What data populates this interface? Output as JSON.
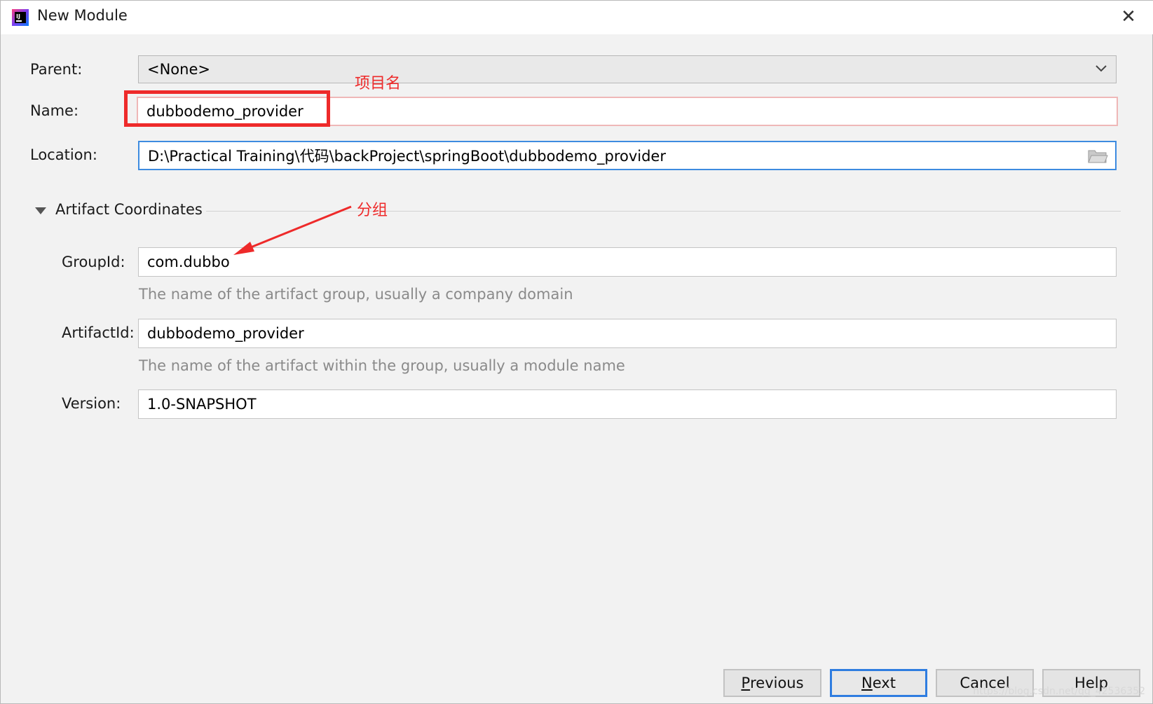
{
  "window": {
    "title": "New Module",
    "close_glyph": "✕",
    "app_icon": "intellij-icon"
  },
  "form": {
    "parent": {
      "label": "Parent:",
      "value": "<None>"
    },
    "name": {
      "label": "Name:",
      "value": "dubbodemo_provider"
    },
    "location": {
      "label": "Location:",
      "value": "D:\\Practical Training\\代码\\backProject\\springBoot\\dubbodemo_provider"
    }
  },
  "artifact": {
    "section_title": "Artifact Coordinates",
    "group_id": {
      "label": "GroupId:",
      "value": "com.dubbo",
      "hint": "The name of the artifact group, usually a company domain"
    },
    "artifact_id": {
      "label": "ArtifactId:",
      "value": "dubbodemo_provider",
      "hint": "The name of the artifact within the group, usually a module name"
    },
    "version": {
      "label": "Version:",
      "value": "1.0-SNAPSHOT"
    }
  },
  "annotations": {
    "project_name": "项目名",
    "group": "分组",
    "color": "#ee2a2a"
  },
  "buttons": {
    "previous": {
      "mnemonic": "P",
      "rest": "revious"
    },
    "next": {
      "mnemonic": "N",
      "rest": "ext"
    },
    "cancel": "Cancel",
    "help": "Help"
  },
  "watermark": "https://blog.csdn.net/qq_42536352",
  "colors": {
    "accent": "#3d8be0",
    "annotation": "#ee2a2a"
  }
}
